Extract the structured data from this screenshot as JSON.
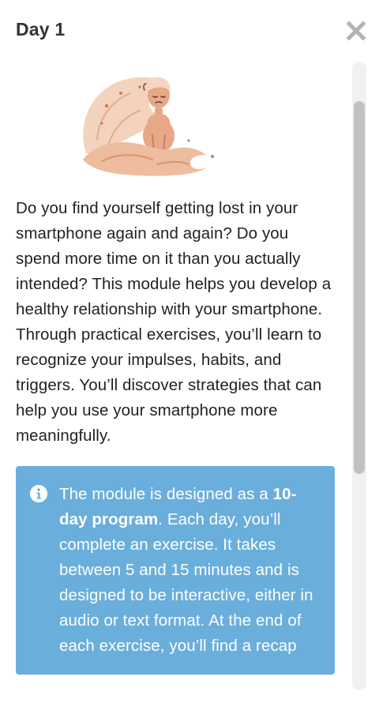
{
  "header": {
    "title": "Day 1"
  },
  "icons": {
    "close": "close-icon",
    "info": "info-icon",
    "illustration": "person-in-wave-illustration"
  },
  "main": {
    "intro": "Do you find yourself getting lost in your smartphone again and again? Do you spend more time on it than you actually intended? This module helps you develop a healthy relationship with your smartphone. Through practical exercises, you’ll learn to recognize your impulses, habits, and triggers. You’ll discover strategies that can help you use your smartphone more meaningfully.",
    "info": {
      "text_before": "The module is designed as a ",
      "bold": "10-day program",
      "text_after": ". Each day, you’ll complete an exercise. It takes between 5 and 15 minutes and is designed to be interactive, either in audio or text format. At the end of each exercise, you’ll find a recap"
    }
  },
  "colors": {
    "info_background": "#6aaedc",
    "illustration_skin": "#e6a887",
    "close_icon": "#b3b3b3"
  }
}
